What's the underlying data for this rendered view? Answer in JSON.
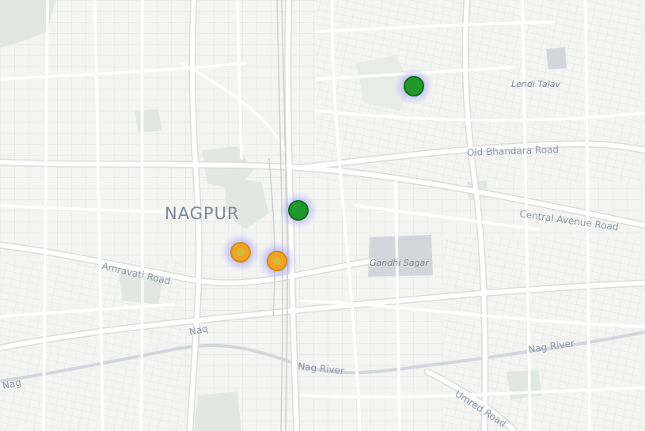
{
  "map": {
    "city_label": "NAGPUR",
    "road_labels": {
      "old_bhandara": "Old Bhandara Road",
      "central_avenue": "Central Avenue Road",
      "amravati": "Amravati Road",
      "umred": "Umred Road",
      "nag_river_west": "Nag River",
      "nag_river_east": "Nag River",
      "nag_river_left": "Nag",
      "naag_west": "Naq"
    },
    "water_labels": {
      "lendi_talav": "Lendi Talav",
      "gandhi_sagar": "Gandhi Sagar"
    },
    "markers": [
      {
        "id": "marker-1",
        "status": "green",
        "color": "#1f9a2a",
        "glow": "#6a6cff"
      },
      {
        "id": "marker-2",
        "status": "green",
        "color": "#1f9a2a",
        "glow": "#6a6cff"
      },
      {
        "id": "marker-3",
        "status": "orange",
        "color": "#f2a324",
        "glow": "#6a6cff"
      },
      {
        "id": "marker-4",
        "status": "orange",
        "color": "#f2a324",
        "glow": "#6a6cff"
      }
    ],
    "colors": {
      "background": "#f4f4f3",
      "road": "#ffffff",
      "road_casing": "#dedede",
      "water": "#d4d8dc",
      "park": "#e3e7e3"
    }
  }
}
